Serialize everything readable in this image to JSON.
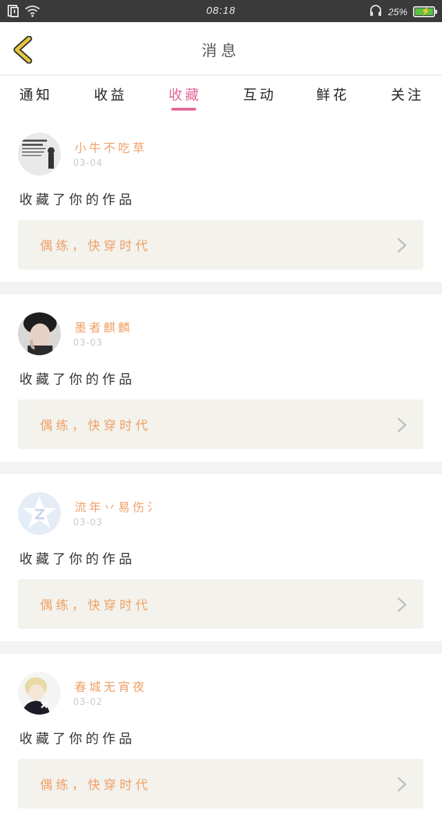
{
  "status_bar": {
    "time": "08:18",
    "battery": "25%"
  },
  "header": {
    "title": "消息"
  },
  "tabs": [
    {
      "label": "通知",
      "active": false
    },
    {
      "label": "收益",
      "active": false
    },
    {
      "label": "收藏",
      "active": true
    },
    {
      "label": "互动",
      "active": false
    },
    {
      "label": "鲜花",
      "active": false
    },
    {
      "label": "关注",
      "active": false
    }
  ],
  "feed": [
    {
      "username": "小牛不吃草",
      "date": "03-04",
      "action": "收藏了你的作品",
      "work_title": "偶练，快穿时代"
    },
    {
      "username": "墨者麒麟",
      "date": "03-03",
      "action": "收藏了你的作品",
      "work_title": "偶练，快穿时代"
    },
    {
      "username": "流年丷易伤氵",
      "date": "03-03",
      "action": "收藏了你的作品",
      "work_title": "偶练，快穿时代"
    },
    {
      "username": "春城无宵夜",
      "date": "03-02",
      "action": "收藏了你的作品",
      "work_title": "偶练，快穿时代"
    }
  ],
  "colors": {
    "accent": "#e2679a",
    "username": "#f0a068",
    "work_bg": "#f3f2ec",
    "back_icon": "#e6c63c"
  }
}
